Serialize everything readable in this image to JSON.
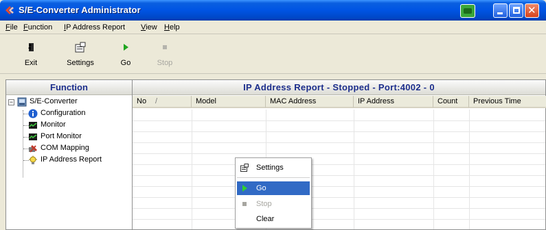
{
  "window": {
    "title": "S/E-Converter Administrator",
    "icons": [
      "app-icon",
      "tray-icon",
      "minimize-icon",
      "maximize-icon",
      "close-icon"
    ]
  },
  "menu": {
    "items": [
      {
        "label": "File",
        "accel": "F",
        "rest": "ile"
      },
      {
        "label": "Function",
        "accel": "F",
        "rest": "unction"
      },
      {
        "label": "IP Address Report",
        "accel": "I",
        "rest": "P Address Report"
      },
      {
        "label": "View",
        "accel": "V",
        "rest": "iew"
      },
      {
        "label": "Help",
        "accel": "H",
        "rest": "elp"
      }
    ]
  },
  "toolbar": {
    "exit_label": "Exit",
    "settings_label": "Settings",
    "go_label": "Go",
    "stop_label": "Stop"
  },
  "left_pane": {
    "header": "Function",
    "tree": {
      "root": "S/E-Converter",
      "children": [
        {
          "label": "Configuration",
          "icon": "info-icon"
        },
        {
          "label": "Monitor",
          "icon": "monitor-icon"
        },
        {
          "label": "Port Monitor",
          "icon": "monitor-icon"
        },
        {
          "label": "COM Mapping",
          "icon": "com-mapping-icon"
        },
        {
          "label": "IP Address Report",
          "icon": "bulb-icon"
        }
      ]
    }
  },
  "right_pane": {
    "header": "IP Address Report - Stopped - Port:4002 - 0",
    "columns": [
      "No",
      "/",
      "Model",
      "MAC Address",
      "IP Address",
      "Count",
      "Previous Time"
    ]
  },
  "context_menu": {
    "items": [
      {
        "label": "Settings",
        "state": "normal"
      },
      {
        "label": "Go",
        "state": "highlighted"
      },
      {
        "label": "Stop",
        "state": "disabled"
      },
      {
        "label": "Clear",
        "state": "normal"
      }
    ]
  },
  "colors": {
    "titlebar": "#0054e3",
    "header_text": "#1c2e8c",
    "menu_highlight": "#316ac5",
    "go_green": "#1fa51f"
  }
}
